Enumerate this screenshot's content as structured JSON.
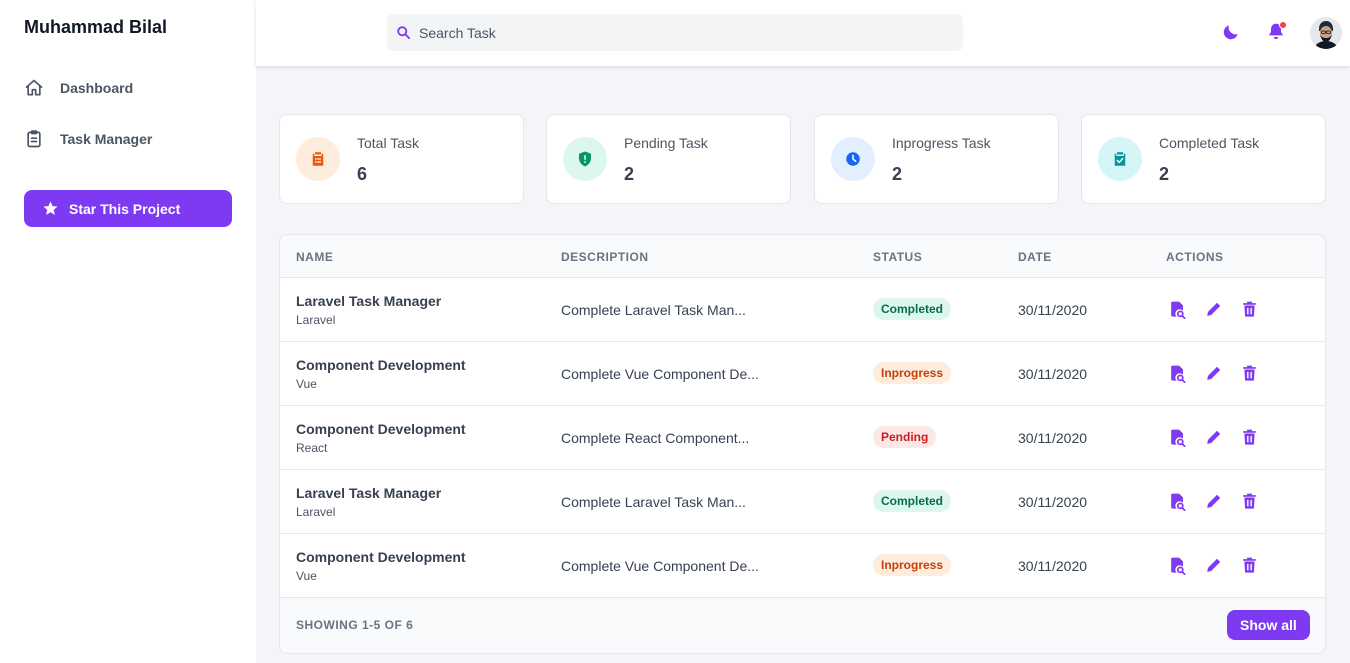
{
  "sidebar": {
    "brand": "Muhammad Bilal",
    "items": [
      {
        "label": "Dashboard",
        "icon": "home-icon"
      },
      {
        "label": "Task Manager",
        "icon": "clipboard-icon"
      }
    ],
    "star_button": "Star This Project"
  },
  "header": {
    "search_placeholder": "Search Task",
    "icons": [
      "moon-icon",
      "bell-icon",
      "avatar"
    ],
    "notification_dot_color": "#ef4444"
  },
  "stats": [
    {
      "label": "Total Task",
      "value": "6",
      "icon": "clipboard-list-icon",
      "bg": "#feecdc",
      "fg": "#ea580c"
    },
    {
      "label": "Pending Task",
      "value": "2",
      "icon": "shield-exclamation-icon",
      "bg": "#def7ec",
      "fg": "#059669"
    },
    {
      "label": "Inprogress Task",
      "value": "2",
      "icon": "clock-icon",
      "bg": "#e1effe",
      "fg": "#1c64f2"
    },
    {
      "label": "Completed Task",
      "value": "2",
      "icon": "clipboard-check-icon",
      "bg": "#d5f5f6",
      "fg": "#0694a2"
    }
  ],
  "table": {
    "headers": [
      "NAME",
      "DESCRIPTION",
      "STATUS",
      "DATE",
      "ACTIONS"
    ],
    "rows": [
      {
        "name": "Laravel Task Manager",
        "sub": "Laravel",
        "desc": "Complete Laravel Task Man...",
        "status": "Completed",
        "status_key": "completed",
        "date": "30/11/2020"
      },
      {
        "name": "Component Development",
        "sub": "Vue",
        "desc": "Complete Vue Component De...",
        "status": "Inprogress",
        "status_key": "inprogress",
        "date": "30/11/2020"
      },
      {
        "name": "Component Development",
        "sub": "React",
        "desc": "Complete React Component...",
        "status": "Pending",
        "status_key": "pending",
        "date": "30/11/2020"
      },
      {
        "name": "Laravel Task Manager",
        "sub": "Laravel",
        "desc": "Complete Laravel Task Man...",
        "status": "Completed",
        "status_key": "completed",
        "date": "30/11/2020"
      },
      {
        "name": "Component Development",
        "sub": "Vue",
        "desc": "Complete Vue Component De...",
        "status": "Inprogress",
        "status_key": "inprogress",
        "date": "30/11/2020"
      }
    ],
    "actions": [
      "view-icon",
      "edit-icon",
      "delete-icon"
    ],
    "footer_text": "SHOWING 1-5 OF 6",
    "show_all": "Show all"
  },
  "colors": {
    "accent": "#7e3af2"
  }
}
